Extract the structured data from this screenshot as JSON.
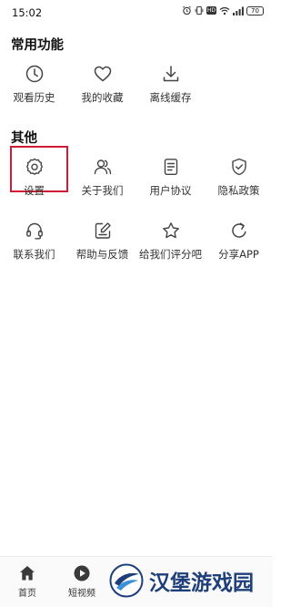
{
  "status_bar": {
    "time": "15:02",
    "battery": "70",
    "icons": [
      "alarm-icon",
      "vibrate-icon",
      "hd-icon",
      "wifi-icon",
      "signal-icon",
      "battery-icon"
    ]
  },
  "sections": {
    "common": {
      "title": "常用功能",
      "items": [
        {
          "label": "观看历史",
          "icon": "clock-icon"
        },
        {
          "label": "我的收藏",
          "icon": "heart-icon"
        },
        {
          "label": "离线缓存",
          "icon": "download-icon"
        }
      ]
    },
    "other": {
      "title": "其他",
      "items": [
        {
          "label": "设置",
          "icon": "gear-icon"
        },
        {
          "label": "关于我们",
          "icon": "users-icon"
        },
        {
          "label": "用户协议",
          "icon": "document-icon"
        },
        {
          "label": "隐私政策",
          "icon": "shield-icon"
        },
        {
          "label": "联系我们",
          "icon": "headset-icon"
        },
        {
          "label": "帮助与反馈",
          "icon": "edit-icon"
        },
        {
          "label": "给我们评分吧",
          "icon": "star-icon"
        },
        {
          "label": "分享APP",
          "icon": "share-refresh-icon"
        }
      ]
    }
  },
  "bottom_nav": {
    "items": [
      {
        "label": "首页",
        "icon": "home-icon"
      },
      {
        "label": "短视频",
        "icon": "play-icon"
      }
    ]
  },
  "watermark": {
    "text": "汉堡游戏园"
  },
  "colors": {
    "highlight": "#d01b34",
    "watermark": "#1e3f7a"
  }
}
